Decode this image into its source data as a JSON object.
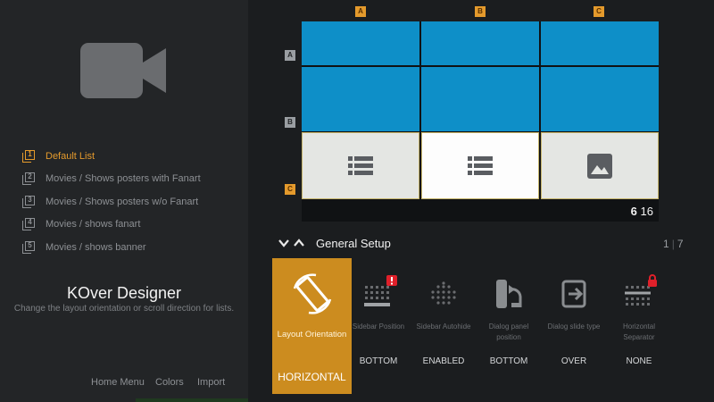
{
  "left_panel": {
    "icon": "video-camera-icon",
    "layouts": [
      {
        "num": "1",
        "label": "Default List",
        "active": true
      },
      {
        "num": "2",
        "label": "Movies / Shows posters with Fanart",
        "active": false
      },
      {
        "num": "3",
        "label": "Movies / Shows posters w/o Fanart",
        "active": false
      },
      {
        "num": "4",
        "label": "Movies / shows fanart",
        "active": false
      },
      {
        "num": "5",
        "label": "Movies / shows banner",
        "active": false
      }
    ],
    "title": "KOver Designer",
    "description": "Change the layout orientation or scroll direction for lists.",
    "bottom_nav": [
      "Home Menu",
      "Colors",
      "Import"
    ]
  },
  "grid_preview": {
    "columns": [
      "A",
      "B",
      "C"
    ],
    "rows": [
      "A",
      "B",
      "C"
    ],
    "active_row": "C",
    "counter_current": "6",
    "counter_total": "16",
    "cell_icons": [
      "list-icon",
      "list-icon",
      "image-icon"
    ]
  },
  "setup": {
    "title": "General Setup",
    "page_current": "1",
    "page_total": "7",
    "options": [
      {
        "label": "Layout Orientation",
        "value": "HORIZONTAL",
        "icon": "rotate-screen-icon",
        "selected": true
      },
      {
        "label": "Sidebar Position",
        "value": "BOTTOM",
        "icon": "sidebar-grid-icon",
        "badge": "!"
      },
      {
        "label": "Sidebar Autohide",
        "value": "ENABLED",
        "icon": "autohide-dots-icon"
      },
      {
        "label": "Dialog panel position",
        "value": "BOTTOM",
        "icon": "panel-position-icon"
      },
      {
        "label": "Dialog slide type",
        "value": "OVER",
        "icon": "slide-arrow-icon"
      },
      {
        "label": "Horizontal Separator",
        "value": "NONE",
        "icon": "separator-grid-icon",
        "locked": true
      }
    ]
  },
  "colors": {
    "accent": "#e49a2c",
    "selected_tile": "#cc8c1f",
    "cell_blue": "#0e8fc8",
    "cell_gray": "#e4e6e3",
    "badge_red": "#e0202a"
  }
}
